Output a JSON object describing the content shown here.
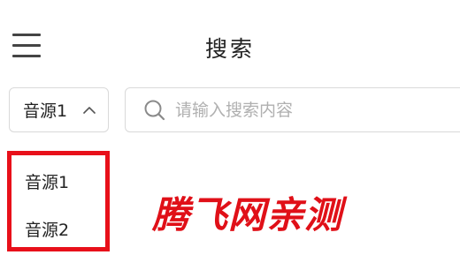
{
  "header": {
    "title": "搜索",
    "menu_icon": "hamburger-menu-icon"
  },
  "source_select": {
    "selected": "音源1",
    "icon": "chevron-up-icon",
    "options": [
      "音源1",
      "音源2"
    ]
  },
  "search": {
    "value": "",
    "placeholder": "请输入搜索内容",
    "icon": "search-icon"
  },
  "watermark": "腾飞网亲测",
  "colors": {
    "highlight_border": "#e8101a",
    "watermark": "#e01018",
    "border": "#d9d9d9",
    "placeholder": "#b0b0b0"
  }
}
